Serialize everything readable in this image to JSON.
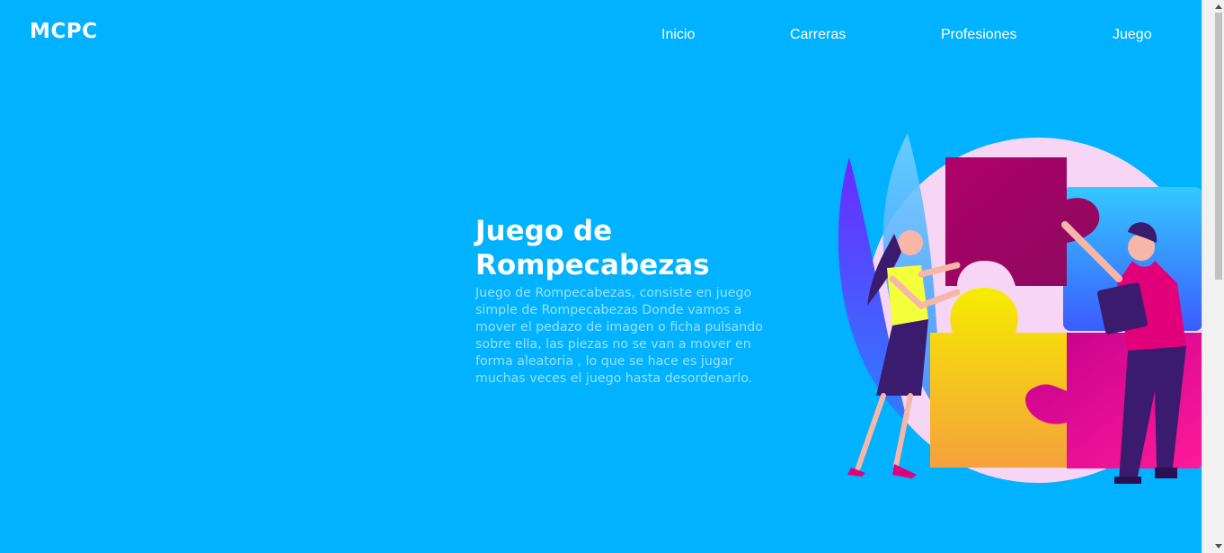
{
  "brand": {
    "logo": "MCPC"
  },
  "nav": {
    "items": [
      {
        "label": "Inicio"
      },
      {
        "label": "Carreras"
      },
      {
        "label": "Profesiones"
      },
      {
        "label": "Juego"
      }
    ]
  },
  "hero": {
    "title": "Juego de Rompecabezas",
    "description": "Juego de Rompecabezas, consiste en juego simple de Rompecabezas Donde vamos a mover el pedazo de imagen o ficha pulsando sobre ella, las piezas no se van a mover en forma aleatoria , lo que se hace es jugar muchas veces el juego hasta desordenarlo."
  },
  "illustration": {
    "name": "puzzle-team-illustration"
  },
  "colors": {
    "background": "#00b2ff",
    "text": "#ffffff",
    "puzzle_magenta": "#a8005f",
    "puzzle_yellow": "#f3e400",
    "puzzle_pink": "#e8009a",
    "puzzle_blue": "#2f7dff"
  }
}
